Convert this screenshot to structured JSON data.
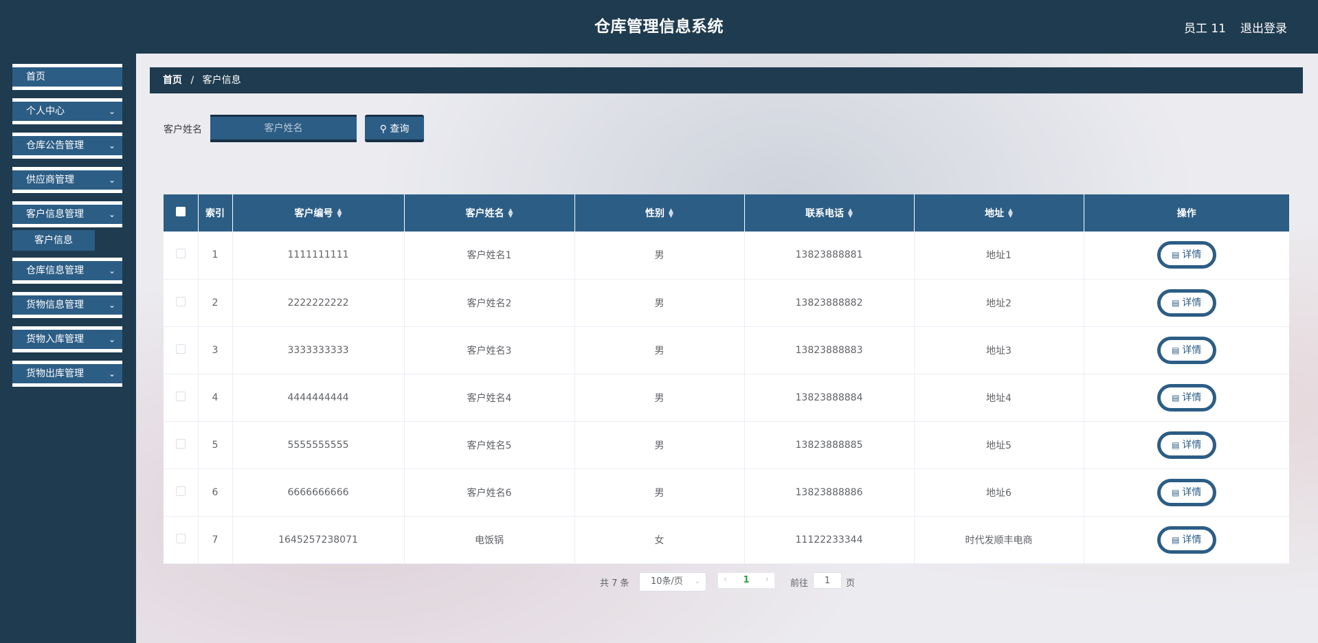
{
  "header": {
    "title": "仓库管理信息系统",
    "user": "员工 11",
    "logout": "退出登录"
  },
  "sidebar": {
    "items": [
      {
        "label": "首页",
        "has_children": false
      },
      {
        "label": "个人中心",
        "has_children": true
      },
      {
        "label": "仓库公告管理",
        "has_children": true
      },
      {
        "label": "供应商管理",
        "has_children": true
      },
      {
        "label": "客户信息管理",
        "has_children": true,
        "expanded": true
      },
      {
        "label": "仓库信息管理",
        "has_children": true
      },
      {
        "label": "货物信息管理",
        "has_children": true
      },
      {
        "label": "货物入库管理",
        "has_children": true
      },
      {
        "label": "货物出库管理",
        "has_children": true
      }
    ],
    "submenu": {
      "label": "客户信息"
    }
  },
  "breadcrumb": {
    "home": "首页",
    "separator": "/",
    "current": "客户信息"
  },
  "search": {
    "label": "客户姓名",
    "placeholder": "客户姓名",
    "button": "查询",
    "button_icon": "search-icon"
  },
  "table": {
    "columns": [
      "索引",
      "客户编号",
      "客户姓名",
      "性别",
      "联系电话",
      "地址",
      "操作"
    ],
    "rows": [
      {
        "index": "1",
        "code": "1111111111",
        "name": "客户姓名1",
        "gender": "男",
        "phone": "13823888881",
        "address": "地址1"
      },
      {
        "index": "2",
        "code": "2222222222",
        "name": "客户姓名2",
        "gender": "男",
        "phone": "13823888882",
        "address": "地址2"
      },
      {
        "index": "3",
        "code": "3333333333",
        "name": "客户姓名3",
        "gender": "男",
        "phone": "13823888883",
        "address": "地址3"
      },
      {
        "index": "4",
        "code": "4444444444",
        "name": "客户姓名4",
        "gender": "男",
        "phone": "13823888884",
        "address": "地址4"
      },
      {
        "index": "5",
        "code": "5555555555",
        "name": "客户姓名5",
        "gender": "男",
        "phone": "13823888885",
        "address": "地址5"
      },
      {
        "index": "6",
        "code": "6666666666",
        "name": "客户姓名6",
        "gender": "男",
        "phone": "13823888886",
        "address": "地址6"
      },
      {
        "index": "7",
        "code": "1645257238071",
        "name": "电饭锅",
        "gender": "女",
        "phone": "11122233344",
        "address": "时代发顺丰电商"
      }
    ],
    "action_label": "详情"
  },
  "pagination": {
    "total": "共 7 条",
    "page_size": "10条/页",
    "current_page": "1",
    "goto_label": "前往",
    "goto_value": "1",
    "page_suffix": "页"
  },
  "colors": {
    "header_bg": "#1f3b4f",
    "accent": "#2c5d85",
    "page_active": "#2ba245"
  }
}
